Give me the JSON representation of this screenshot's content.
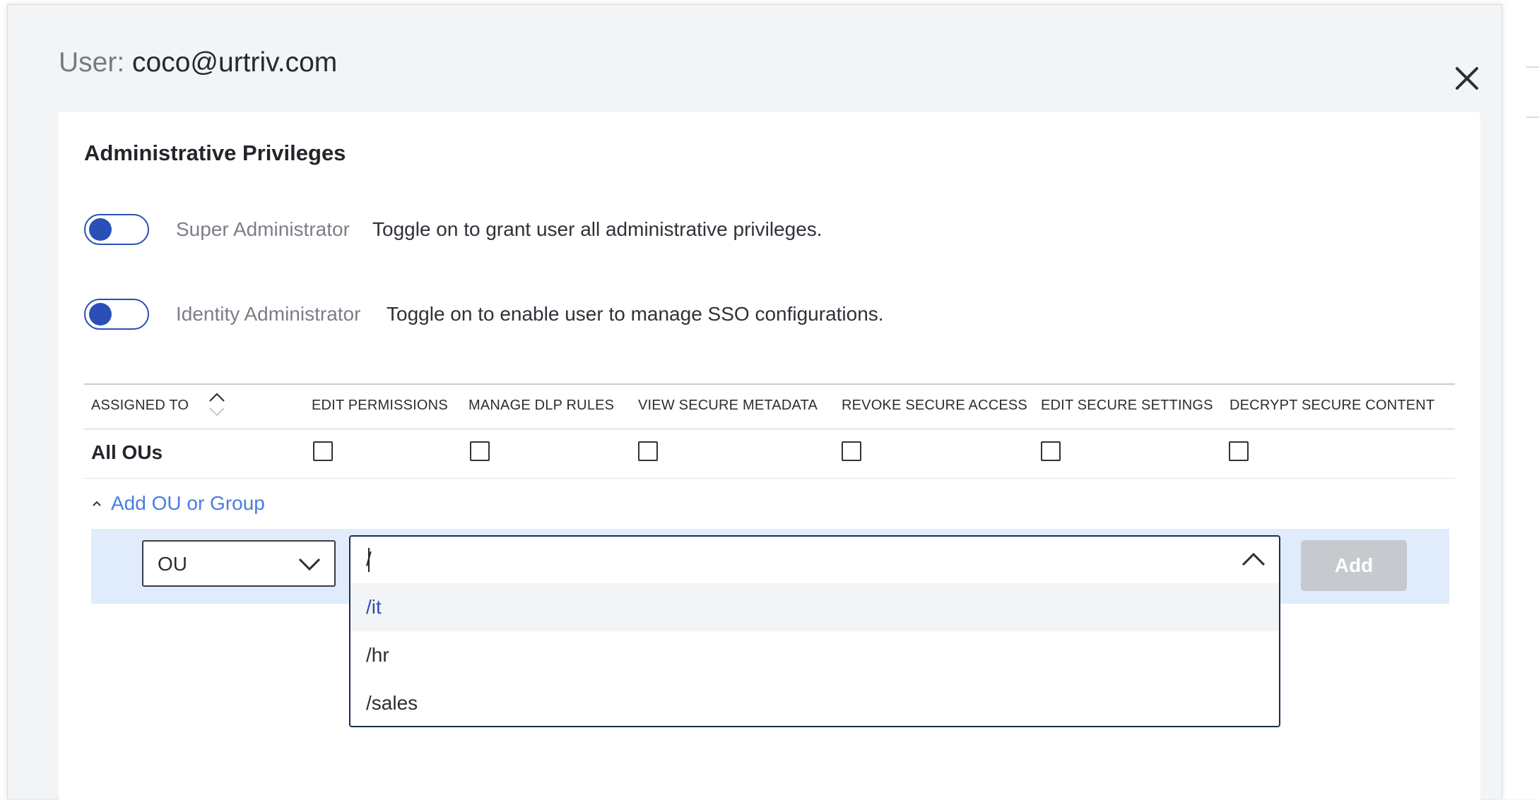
{
  "modal": {
    "title_prefix": "User:",
    "title_user": "coco@urtriv.com"
  },
  "section": {
    "title": "Administrative Privileges"
  },
  "toggles": [
    {
      "name": "Super Administrator",
      "description": "Toggle on to grant user all administrative privileges.",
      "state": "off"
    },
    {
      "name": "Identity Administrator",
      "description": "Toggle on to enable user to manage SSO configurations.",
      "state": "off"
    }
  ],
  "table": {
    "headers": [
      "ASSIGNED TO",
      "EDIT PERMISSIONS",
      "MANAGE DLP RULES",
      "VIEW SECURE METADATA",
      "REVOKE SECURE ACCESS",
      "EDIT SECURE SETTINGS",
      "DECRYPT SECURE CONTENT"
    ],
    "rows": [
      {
        "label": "All OUs",
        "checks": [
          false,
          false,
          false,
          false,
          false,
          false
        ]
      }
    ]
  },
  "add_section": {
    "toggle_label": "Add OU or Group",
    "expanded": true,
    "type_select": {
      "value": "OU"
    },
    "path_input": {
      "value": "/",
      "open": true,
      "options": [
        "/it",
        "/hr",
        "/sales"
      ],
      "highlighted_index": 0
    },
    "add_button": "Add"
  },
  "colors": {
    "accent": "#2a4fb6",
    "link": "#4a7ce0",
    "panel_bg": "#e0ecfb",
    "disabled_button": "#c6c9cd"
  },
  "icons": {
    "close": "close-icon",
    "sort": "sort-icon",
    "select_arrow": "chevron-down-icon",
    "combo_arrow": "chevron-up-icon",
    "add_toggle": "chevron-up-icon"
  }
}
